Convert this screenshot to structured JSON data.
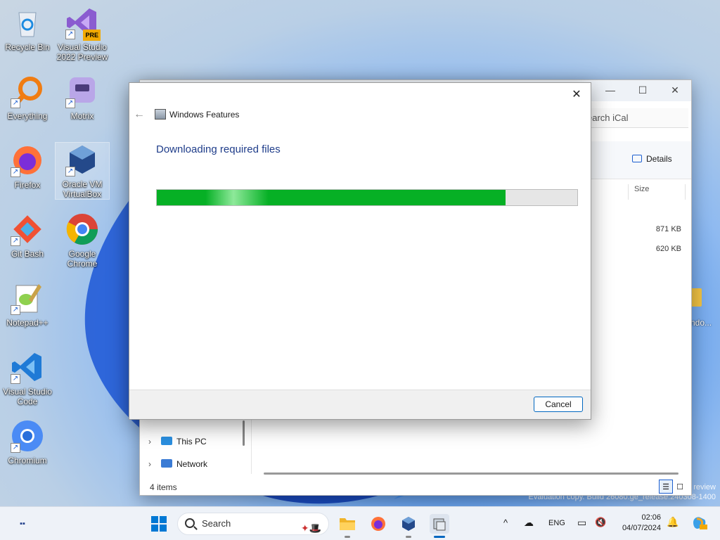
{
  "desktop": {
    "icons": [
      {
        "label": "Recycle Bin"
      },
      {
        "label": "Visual Studio 2022 Preview",
        "badge": "PRE"
      },
      {
        "label": "Everything"
      },
      {
        "label": "Motrix"
      },
      {
        "label": "Firefox"
      },
      {
        "label": "Oracle VM VirtualBox"
      },
      {
        "label": "Git Bash"
      },
      {
        "label": "Google Chrome"
      },
      {
        "label": "Notepad++"
      },
      {
        "label": "Visual Studio Code"
      },
      {
        "label": "Chromium"
      }
    ],
    "partial_label": "ndo...",
    "watermark_line1": "review",
    "watermark_line2": "Evaluation copy. Build 26080.ge_release.240308-1400"
  },
  "explorer": {
    "search_placeholder": "earch iCal",
    "details_label": "Details",
    "column_size": "Size",
    "sizes": [
      "871 KB",
      "620 KB"
    ],
    "nav": [
      {
        "label": "This PC",
        "icon": "monitor-icon"
      },
      {
        "label": "Network",
        "icon": "network-icon"
      }
    ],
    "status": "4 items"
  },
  "dialog": {
    "title": "Windows Features",
    "heading": "Downloading required files",
    "progress": 0.83,
    "cancel_label": "Cancel"
  },
  "taskbar": {
    "search_label": "Search",
    "language": "ENG",
    "time": "02:06",
    "date": "04/07/2024",
    "colors": {
      "accent": "#0067c0",
      "progress": "#06b025"
    }
  }
}
